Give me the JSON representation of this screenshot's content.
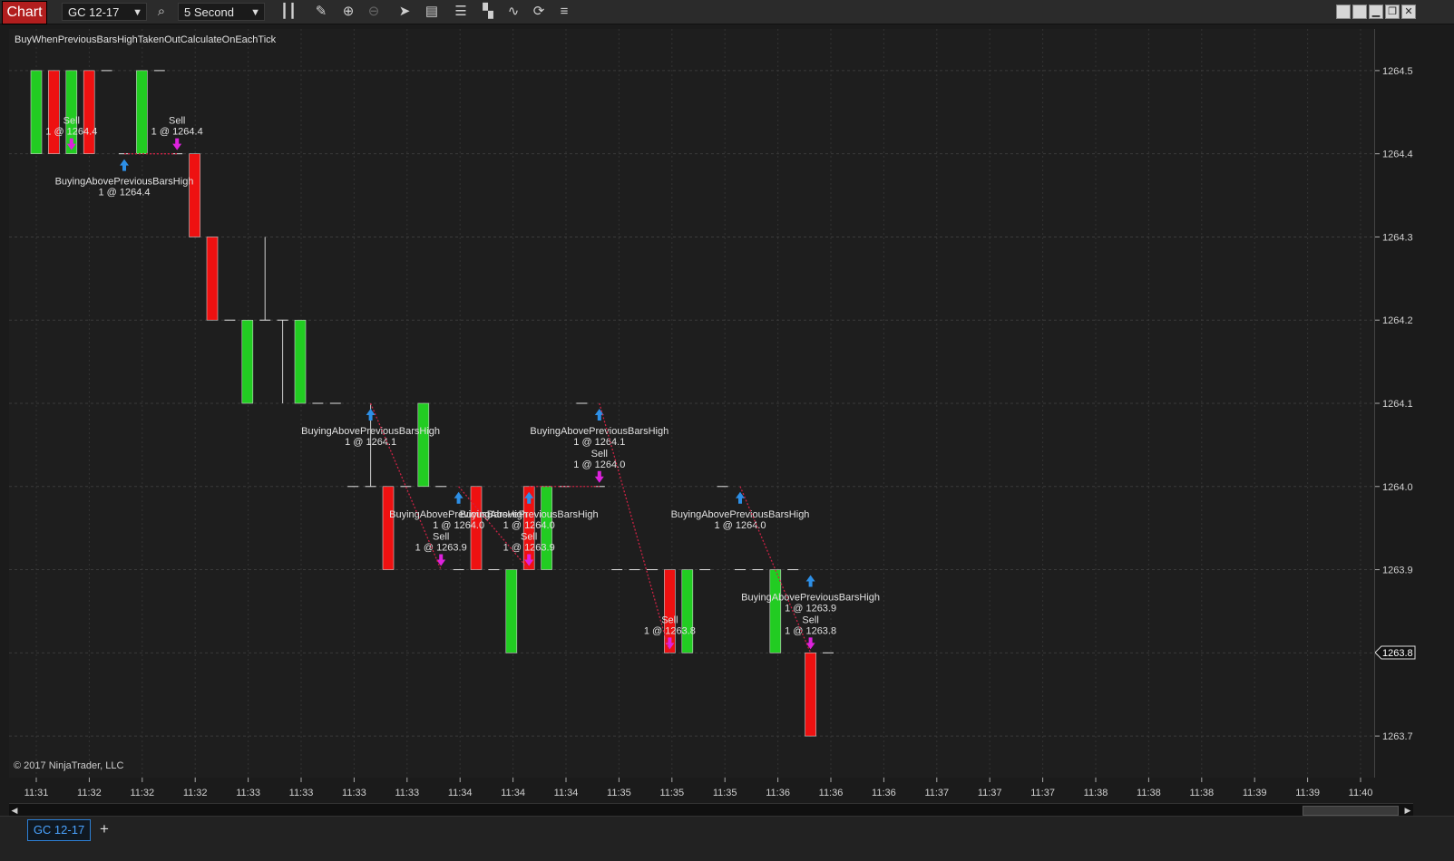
{
  "toolbar": {
    "chart_label": "Chart",
    "instrument": "GC 12-17",
    "interval": "5 Second",
    "icons": [
      "search-icon",
      "bar-type-icon",
      "pencil-icon",
      "zoom-in-icon",
      "zoom-out-icon",
      "pointer-icon",
      "data-box-icon",
      "bar-width-icon",
      "step-icon",
      "strategy-icon",
      "refresh-icon",
      "properties-icon"
    ],
    "window_buttons": [
      "tile",
      "tile",
      "minimize",
      "restore",
      "close"
    ]
  },
  "strategy_name": "BuyWhenPreviousBarsHighTakenOutCalculateOnEachTick",
  "copyright": "© 2017 NinjaTrader, LLC",
  "current_price_label": "1263.8",
  "tab_label": "GC 12-17",
  "colors": {
    "up": "#22cc22",
    "down": "#ee1111",
    "buy_arrow": "#2d8fe6",
    "sell_arrow": "#dd22dd",
    "exit_line": "#cc2244",
    "win_line": "#1e8a1e"
  },
  "chart_data": {
    "type": "candlestick",
    "ylim": [
      1263.65,
      1264.55
    ],
    "y_ticks": [
      1264.5,
      1264.4,
      1264.3,
      1264.2,
      1264.1,
      1264.0,
      1263.9,
      1263.8,
      1263.7
    ],
    "x_tick_labels": [
      "11:31",
      "11:32",
      "11:32",
      "11:32",
      "11:33",
      "11:33",
      "11:33",
      "11:33",
      "11:34",
      "11:34",
      "11:34",
      "11:35",
      "11:35",
      "11:35",
      "11:36",
      "11:36",
      "11:36",
      "11:37",
      "11:37",
      "11:37",
      "11:38",
      "11:38",
      "11:38",
      "11:39",
      "11:39",
      "11:40"
    ],
    "bars": [
      {
        "o": 1264.4,
        "h": 1264.5,
        "l": 1264.4,
        "c": 1264.5
      },
      {
        "o": 1264.5,
        "h": 1264.5,
        "l": 1264.4,
        "c": 1264.4
      },
      {
        "o": 1264.4,
        "h": 1264.5,
        "l": 1264.4,
        "c": 1264.5
      },
      {
        "o": 1264.5,
        "h": 1264.5,
        "l": 1264.4,
        "c": 1264.4
      },
      {
        "o": 1264.5,
        "h": 1264.5,
        "l": 1264.5,
        "c": 1264.5
      },
      {
        "o": 1264.4,
        "h": 1264.4,
        "l": 1264.4,
        "c": 1264.4
      },
      {
        "o": 1264.4,
        "h": 1264.5,
        "l": 1264.4,
        "c": 1264.5
      },
      {
        "o": 1264.5,
        "h": 1264.5,
        "l": 1264.5,
        "c": 1264.5
      },
      {
        "o": 1264.4,
        "h": 1264.4,
        "l": 1264.4,
        "c": 1264.4
      },
      {
        "o": 1264.4,
        "h": 1264.4,
        "l": 1264.3,
        "c": 1264.3
      },
      {
        "o": 1264.3,
        "h": 1264.3,
        "l": 1264.2,
        "c": 1264.2
      },
      {
        "o": 1264.2,
        "h": 1264.2,
        "l": 1264.2,
        "c": 1264.2
      },
      {
        "o": 1264.1,
        "h": 1264.2,
        "l": 1264.1,
        "c": 1264.2
      },
      {
        "o": 1264.2,
        "h": 1264.3,
        "l": 1264.2,
        "c": 1264.2
      },
      {
        "o": 1264.2,
        "h": 1264.2,
        "l": 1264.1,
        "c": 1264.2
      },
      {
        "o": 1264.1,
        "h": 1264.2,
        "l": 1264.1,
        "c": 1264.2
      },
      {
        "o": 1264.1,
        "h": 1264.1,
        "l": 1264.1,
        "c": 1264.1
      },
      {
        "o": 1264.1,
        "h": 1264.1,
        "l": 1264.1,
        "c": 1264.1
      },
      {
        "o": 1264.0,
        "h": 1264.0,
        "l": 1264.0,
        "c": 1264.0
      },
      {
        "o": 1264.0,
        "h": 1264.1,
        "l": 1264.0,
        "c": 1264.0
      },
      {
        "o": 1264.0,
        "h": 1264.0,
        "l": 1263.9,
        "c": 1263.9
      },
      {
        "o": 1264.0,
        "h": 1264.0,
        "l": 1264.0,
        "c": 1264.0
      },
      {
        "o": 1264.0,
        "h": 1264.1,
        "l": 1264.0,
        "c": 1264.1
      },
      {
        "o": 1264.0,
        "h": 1264.0,
        "l": 1264.0,
        "c": 1264.0
      },
      {
        "o": 1263.9,
        "h": 1263.9,
        "l": 1263.9,
        "c": 1263.9
      },
      {
        "o": 1264.0,
        "h": 1264.0,
        "l": 1263.9,
        "c": 1263.9
      },
      {
        "o": 1263.9,
        "h": 1263.9,
        "l": 1263.9,
        "c": 1263.9
      },
      {
        "o": 1263.8,
        "h": 1263.9,
        "l": 1263.8,
        "c": 1263.9
      },
      {
        "o": 1264.0,
        "h": 1264.0,
        "l": 1263.9,
        "c": 1263.9
      },
      {
        "o": 1263.9,
        "h": 1264.0,
        "l": 1263.9,
        "c": 1264.0
      },
      {
        "o": 1264.0,
        "h": 1264.0,
        "l": 1264.0,
        "c": 1264.0
      },
      {
        "o": 1264.1,
        "h": 1264.1,
        "l": 1264.1,
        "c": 1264.1
      },
      {
        "o": 1264.0,
        "h": 1264.0,
        "l": 1264.0,
        "c": 1264.0
      },
      {
        "o": 1263.9,
        "h": 1263.9,
        "l": 1263.9,
        "c": 1263.9
      },
      {
        "o": 1263.9,
        "h": 1263.9,
        "l": 1263.9,
        "c": 1263.9
      },
      {
        "o": 1263.9,
        "h": 1263.9,
        "l": 1263.9,
        "c": 1263.9
      },
      {
        "o": 1263.9,
        "h": 1263.9,
        "l": 1263.8,
        "c": 1263.8
      },
      {
        "o": 1263.8,
        "h": 1263.9,
        "l": 1263.8,
        "c": 1263.9
      },
      {
        "o": 1263.9,
        "h": 1263.9,
        "l": 1263.9,
        "c": 1263.9
      },
      {
        "o": 1264.0,
        "h": 1264.0,
        "l": 1264.0,
        "c": 1264.0
      },
      {
        "o": 1263.9,
        "h": 1263.9,
        "l": 1263.9,
        "c": 1263.9
      },
      {
        "o": 1263.9,
        "h": 1263.9,
        "l": 1263.9,
        "c": 1263.9
      },
      {
        "o": 1263.8,
        "h": 1263.9,
        "l": 1263.8,
        "c": 1263.9
      },
      {
        "o": 1263.9,
        "h": 1263.9,
        "l": 1263.9,
        "c": 1263.9
      },
      {
        "o": 1263.8,
        "h": 1263.8,
        "l": 1263.7,
        "c": 1263.7
      },
      {
        "o": 1263.8,
        "h": 1263.8,
        "l": 1263.8,
        "c": 1263.8
      }
    ],
    "executions": [
      {
        "bar": 2,
        "side": "sell",
        "text": "Sell",
        "price_text": "1 @ 1264.4"
      },
      {
        "bar": 5,
        "side": "buy",
        "text": "BuyingAbovePreviousBarsHigh",
        "price_text": "1 @ 1264.4"
      },
      {
        "bar": 8,
        "side": "sell",
        "text": "Sell",
        "price_text": "1 @ 1264.4"
      },
      {
        "bar": 19,
        "side": "buy",
        "text": "BuyingAbovePreviousBarsHigh",
        "price_text": "1 @ 1264.1"
      },
      {
        "bar": 23,
        "side": "sell",
        "text": "Sell",
        "price_text": "1 @ 1263.9"
      },
      {
        "bar": 24,
        "side": "buy",
        "text": "BuyingAbovePreviousBarsHigh",
        "price_text": "1 @ 1264.0"
      },
      {
        "bar": 28,
        "side": "sell",
        "text": "Sell",
        "price_text": "1 @ 1263.9"
      },
      {
        "bar": 28,
        "side": "buy",
        "text": "BuyingAbovePreviousBarsHigh",
        "price_text": "1 @ 1264.0"
      },
      {
        "bar": 32,
        "side": "sell",
        "text": "Sell",
        "price_text": "1 @ 1264.0"
      },
      {
        "bar": 32,
        "side": "buy",
        "text": "BuyingAbovePreviousBarsHigh",
        "price_text": "1 @ 1264.1"
      },
      {
        "bar": 36,
        "side": "sell",
        "text": "Sell",
        "price_text": "1 @ 1263.8"
      },
      {
        "bar": 40,
        "side": "buy",
        "text": "BuyingAbovePreviousBarsHigh",
        "price_text": "1 @ 1264.0"
      },
      {
        "bar": 44,
        "side": "sell",
        "text": "Sell",
        "price_text": "1 @ 1263.8"
      },
      {
        "bar": 44,
        "side": "buy",
        "text": "BuyingAbovePreviousBarsHigh",
        "price_text": "1 @ 1263.9"
      }
    ]
  }
}
